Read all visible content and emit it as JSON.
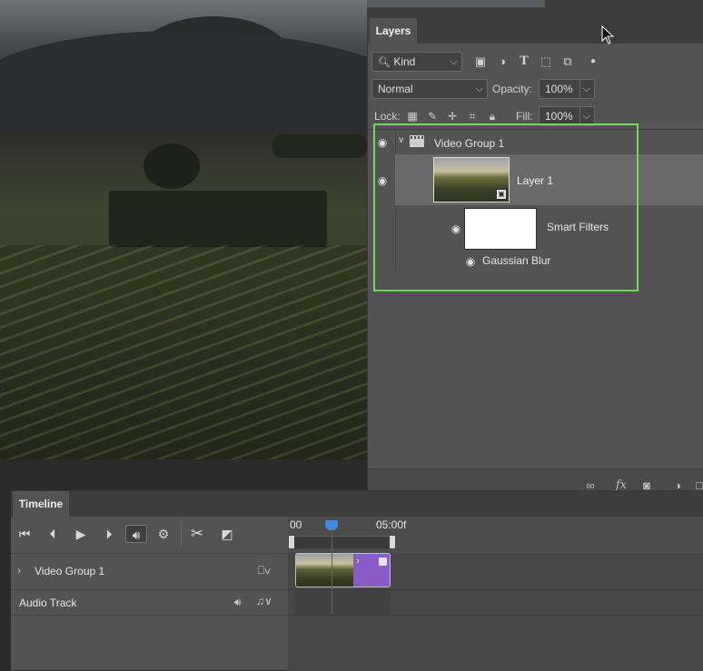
{
  "layers_panel": {
    "tab": "Layers",
    "filter_kind": "Kind",
    "blend_mode": "Normal",
    "opacity_label": "Opacity:",
    "opacity_value": "100%",
    "lock_label": "Lock:",
    "fill_label": "Fill:",
    "fill_value": "100%",
    "layers": {
      "group_name": "Video Group 1",
      "layer_name": "Layer 1",
      "smart_filters_label": "Smart Filters",
      "filter_name": "Gaussian Blur"
    },
    "selection_color": "#6ddc54"
  },
  "timeline": {
    "tab": "Timeline",
    "ruler_start": "00",
    "ruler_end": "05:00f",
    "tracks": {
      "video_group": "Video Group 1",
      "audio_track": "Audio Track"
    },
    "clip_color": "#8a5cc7",
    "playhead_color": "#d23232"
  },
  "icons": {
    "filter": [
      "search-icon",
      "image-filter-icon",
      "adjustment-filter-icon",
      "type-filter-icon",
      "shape-filter-icon",
      "smart-object-filter-icon",
      "filter-toggle-icon"
    ],
    "lock": [
      "lock-pixels-icon",
      "lock-image-icon",
      "lock-position-icon",
      "lock-artboard-icon",
      "lock-all-icon"
    ],
    "bottom": [
      "link-icon",
      "fx-icon",
      "mask-icon",
      "adjustment-icon",
      "new-layer-icon"
    ]
  }
}
